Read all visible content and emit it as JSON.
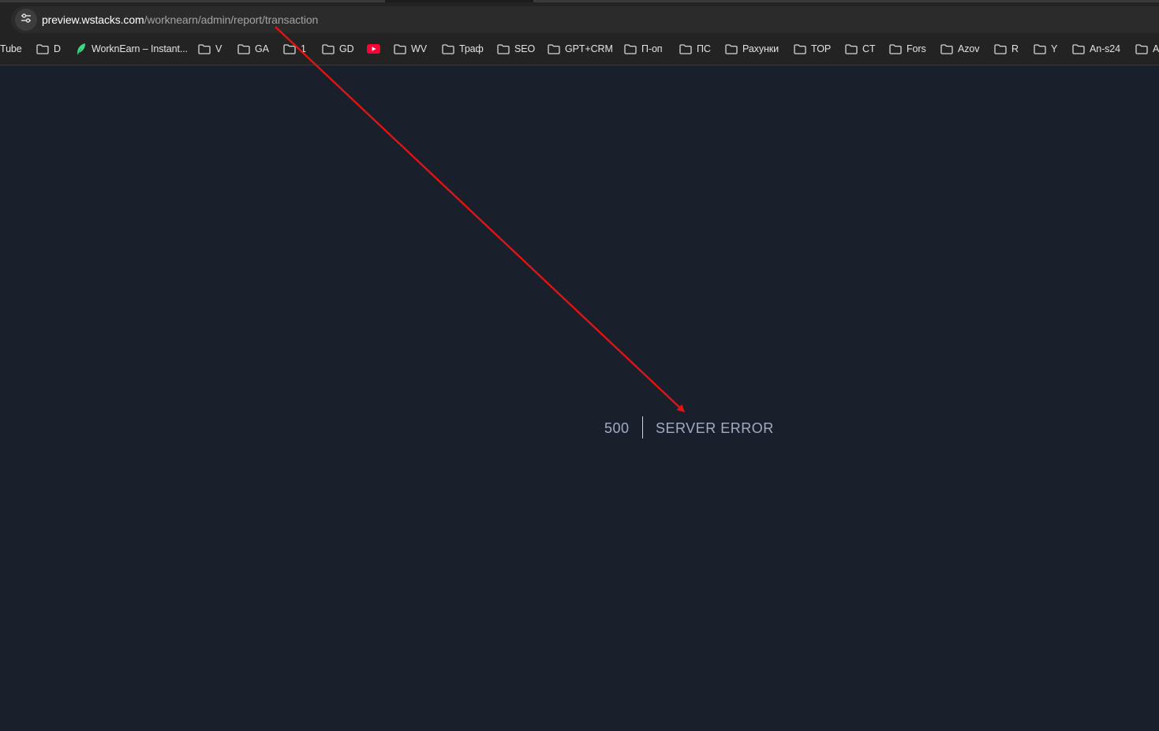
{
  "browser": {
    "address_bar": {
      "url_domain": "preview.wstacks.com",
      "url_path": "/worknearn/admin/report/transaction",
      "site_info_icon": "tune-icon"
    },
    "bookmarks": [
      {
        "label": "Tube",
        "icon": "youtube-partial"
      },
      {
        "label": "D",
        "icon": "folder-icon"
      },
      {
        "label": "WorknEarn – Instant...",
        "icon": "leaf-icon"
      },
      {
        "label": "V",
        "icon": "folder-icon"
      },
      {
        "label": "GA",
        "icon": "folder-icon"
      },
      {
        "label": "1",
        "icon": "folder-icon"
      },
      {
        "label": "GD",
        "icon": "folder-icon"
      },
      {
        "label": "",
        "icon": "youtube-icon"
      },
      {
        "label": "WV",
        "icon": "folder-icon"
      },
      {
        "label": "Траф",
        "icon": "folder-icon"
      },
      {
        "label": "SEO",
        "icon": "folder-icon"
      },
      {
        "label": "GPT+CRM",
        "icon": "folder-icon"
      },
      {
        "label": "П-оп",
        "icon": "folder-icon"
      },
      {
        "label": "ПС",
        "icon": "folder-icon"
      },
      {
        "label": "Рахунки",
        "icon": "folder-icon"
      },
      {
        "label": "TOP",
        "icon": "folder-icon"
      },
      {
        "label": "CT",
        "icon": "folder-icon"
      },
      {
        "label": "Fors",
        "icon": "folder-icon"
      },
      {
        "label": "Azov",
        "icon": "folder-icon"
      },
      {
        "label": "R",
        "icon": "folder-icon"
      },
      {
        "label": "Y",
        "icon": "folder-icon"
      },
      {
        "label": "An-s24",
        "icon": "folder-icon"
      },
      {
        "label": "A",
        "icon": "folder-icon"
      }
    ]
  },
  "page": {
    "error_code": "500",
    "error_message": "SERVER ERROR"
  },
  "annotation": {
    "type": "arrow",
    "color": "#e11414"
  },
  "colors": {
    "page_background": "#1a1f2c",
    "error_text": "#a0aec0",
    "browser_chrome": "#232323",
    "youtube_red": "#ff0033",
    "leaf_green": "#3ddc84"
  }
}
